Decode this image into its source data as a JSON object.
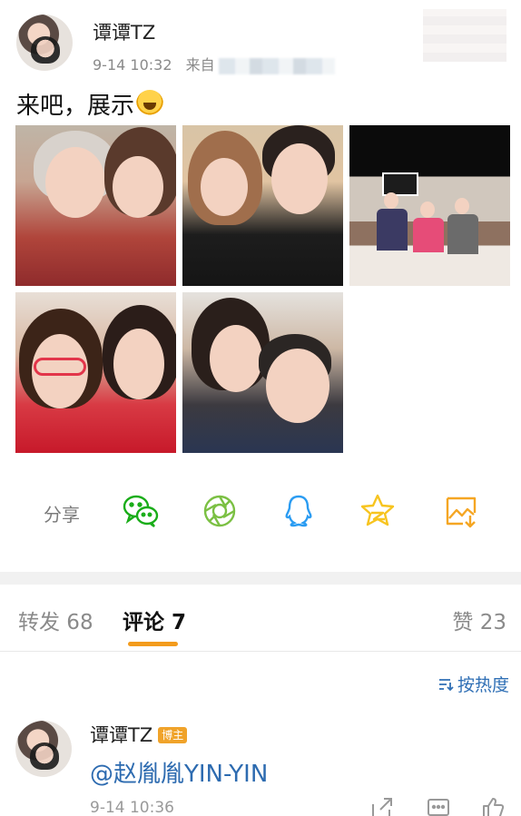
{
  "post": {
    "user_name": "谭谭TZ",
    "time": "9-14 10:32",
    "source_prefix": "来自",
    "text": "来吧，展示",
    "emoji_icon": "rolling-laughing-emoji",
    "photos": [
      {
        "name": "photo-elder-woman-selfie"
      },
      {
        "name": "photo-couple-selfie"
      },
      {
        "name": "photo-group-table"
      },
      {
        "name": "photo-glasses-woman-selfie"
      },
      {
        "name": "photo-mother-son-selfie"
      }
    ]
  },
  "share": {
    "label": "分享",
    "buttons": [
      {
        "icon": "wechat-icon",
        "color": "#1aad19"
      },
      {
        "icon": "moments-icon",
        "color": "#7bc043"
      },
      {
        "icon": "qq-icon",
        "color": "#2b9cf2"
      },
      {
        "icon": "qzone-star-icon",
        "color": "#f7c41f"
      },
      {
        "icon": "save-image-icon",
        "color": "#f5a623"
      }
    ]
  },
  "tabs": {
    "repost": "转发 68",
    "comment": "评论 7",
    "like": "赞 23",
    "accent": "#f39b1c"
  },
  "sort": {
    "label": "按热度",
    "icon": "sort-icon"
  },
  "comment": {
    "user_name": "谭谭TZ",
    "badge": "博主",
    "text": "@赵胤胤YIN-YIN",
    "time": "9-14 10:36",
    "actions": [
      "share-icon",
      "reply-icon",
      "like-icon"
    ]
  }
}
